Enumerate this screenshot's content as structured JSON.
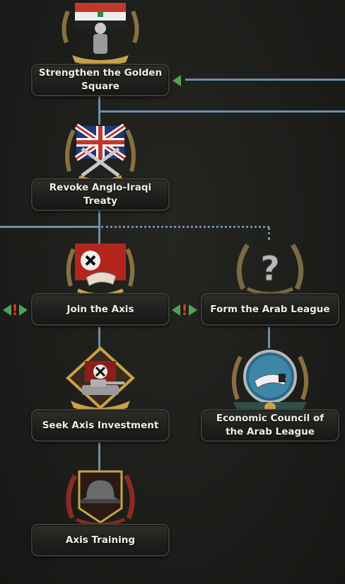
{
  "focus_tree": {
    "focuses": [
      {
        "id": "strengthen_golden_square",
        "label": "Strengthen the Golden Square",
        "icon": "iraq-flag-soldier-icon"
      },
      {
        "id": "revoke_anglo_iraqi_treaty",
        "label": "Revoke Anglo-Iraqi Treaty",
        "icon": "union-jack-swords-icon"
      },
      {
        "id": "join_the_axis",
        "label": "Join the Axis",
        "icon": "axis-flag-handshake-icon"
      },
      {
        "id": "form_the_arab_league",
        "label": "Form the Arab League",
        "icon": "unknown-question-mark-icon"
      },
      {
        "id": "seek_axis_investment",
        "label": "Seek Axis Investment",
        "icon": "axis-tank-icon"
      },
      {
        "id": "economic_council_arab_league",
        "label": "Economic Council of the Arab League",
        "icon": "handshake-globe-icon"
      },
      {
        "id": "axis_training",
        "label": "Axis Training",
        "icon": "german-helmet-icon"
      }
    ]
  },
  "colors": {
    "connector": "#6f8ea7",
    "mutual_exclusive_arrow": "#4fa352",
    "mutual_exclusive_mark": "#e23a2a",
    "label_text": "#f1efe6"
  }
}
